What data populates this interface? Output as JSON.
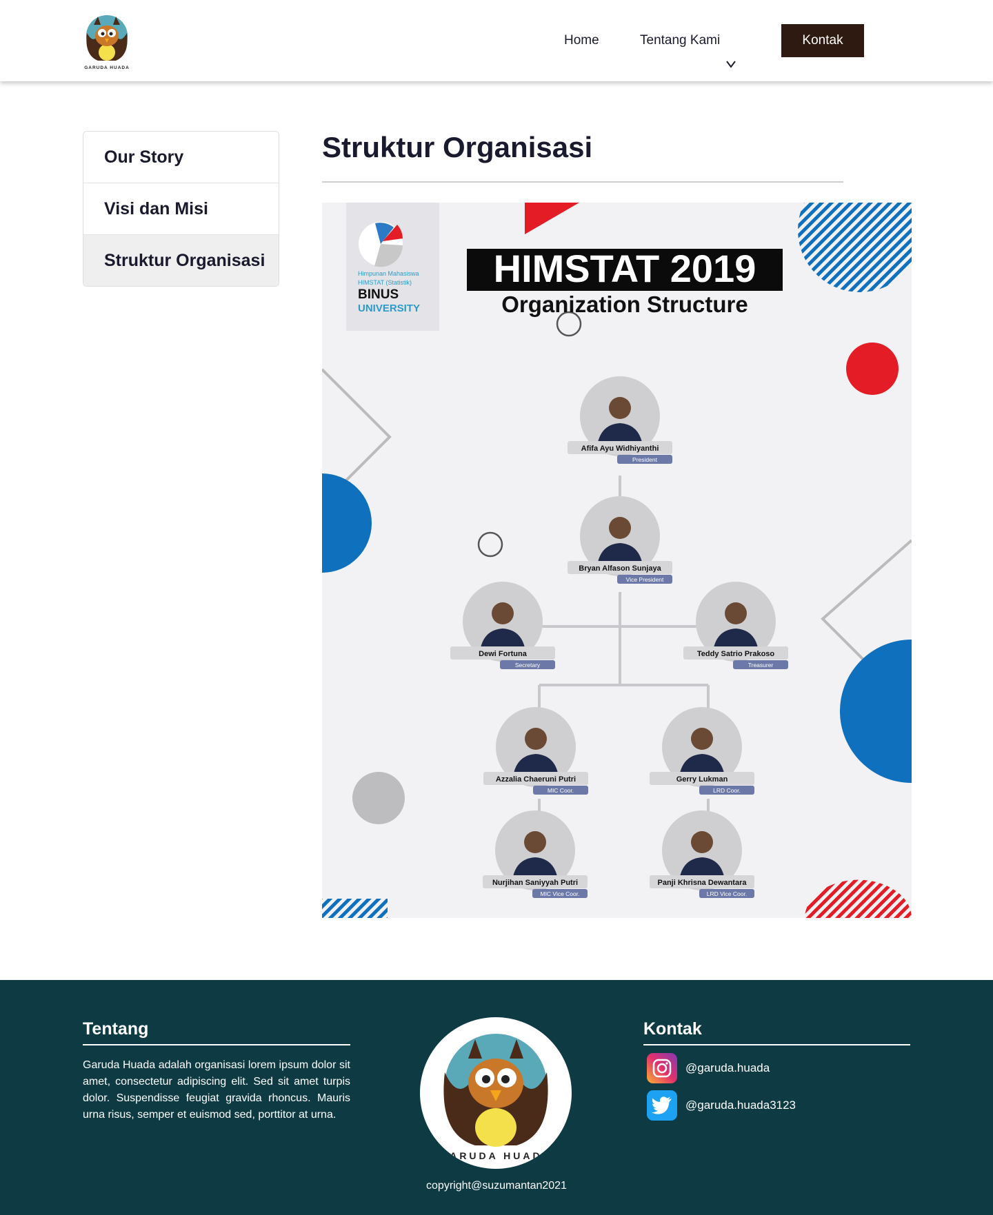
{
  "header": {
    "logo_name": "GARUDA HUADA",
    "nav": {
      "home": "Home",
      "about": "Tentang Kami",
      "contact": "Kontak"
    }
  },
  "sidebar": {
    "items": [
      {
        "label": "Our Story"
      },
      {
        "label": "Visi dan Misi"
      },
      {
        "label": "Struktur Organisasi"
      }
    ]
  },
  "main": {
    "title": "Struktur Organisasi",
    "image": {
      "badge_lines": [
        "Himpunan Mahasiswa",
        "HIMSTAT (Statistik)",
        "BINUS",
        "UNIVERSITY"
      ],
      "heading": "HIMSTAT 2019",
      "subheading": "Organization Structure",
      "members": [
        {
          "name": "Afifa Ayu Widhiyanthi",
          "role": "President"
        },
        {
          "name": "Bryan Alfason Sunjaya",
          "role": "Vice President"
        },
        {
          "name": "Dewi Fortuna",
          "role": "Secretary"
        },
        {
          "name": "Teddy Satrio Prakoso",
          "role": "Treasurer"
        },
        {
          "name": "Azzalia Chaeruni Putri",
          "role": "MIC Coor."
        },
        {
          "name": "Gerry Lukman",
          "role": "LRD Coor."
        },
        {
          "name": "Nurjihan Saniyyah Putri",
          "role": "MIC Vice Coor."
        },
        {
          "name": "Panji Khrisna Dewantara",
          "role": "LRD Vice Coor."
        }
      ]
    }
  },
  "footer": {
    "about_heading": "Tentang",
    "about_text": "Garuda Huada adalah organisasi lorem ipsum dolor sit amet, consectetur adipiscing elit. Sed sit amet turpis dolor. Suspendisse feugiat gravida rhoncus. Mauris urna risus, semper et euismod sed, porttitor at urna.",
    "contact_heading": "Kontak",
    "instagram": "@garuda.huada",
    "twitter": "@garuda.huada3123",
    "copyright": "copyright@suzumantan2021"
  },
  "colors": {
    "brand_dark": "#2e1a10",
    "footer_bg": "#0e3b43",
    "accent_blue": "#0f70bd",
    "accent_red": "#e31c25"
  },
  "icons": [
    "owl-logo",
    "chevron-down-icon",
    "instagram-icon",
    "twitter-icon"
  ]
}
